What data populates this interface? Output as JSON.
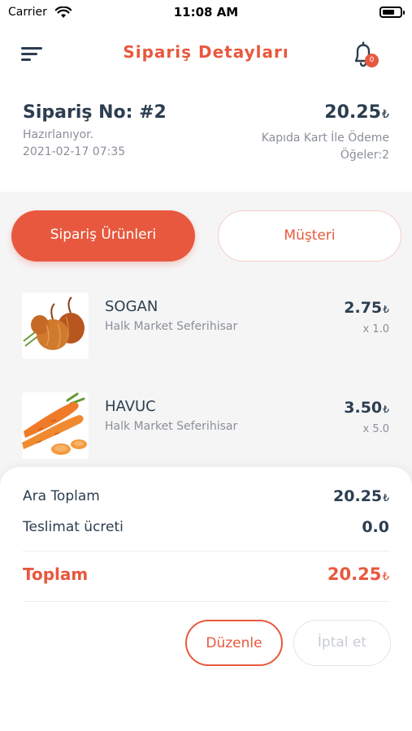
{
  "status_bar": {
    "carrier": "Carrier",
    "time": "11:08 AM"
  },
  "nav": {
    "title": "Sipariş Detayları",
    "notification_count": "0"
  },
  "order": {
    "number": "Sipariş No: #2",
    "status": "Hazırlanıyor.",
    "date": "2021-02-17 07:35",
    "total": "20.25",
    "currency": "₺",
    "payment_method": "Kapıda Kart İle Ödeme",
    "items_count": "Öğeler:2"
  },
  "tabs": {
    "products": "Sipariş Ürünleri",
    "customer": "Müşteri"
  },
  "products": [
    {
      "name": "SOGAN",
      "store": "Halk Market Seferihisar",
      "price": "2.75",
      "qty": "x 1.0"
    },
    {
      "name": "HAVUC",
      "store": "Halk Market Seferihisar",
      "price": "3.50",
      "qty": "x 5.0"
    }
  ],
  "summary": {
    "subtotal_label": "Ara Toplam",
    "subtotal_value": "20.25",
    "delivery_label": "Teslimat ücreti",
    "delivery_value": "0.0",
    "total_label": "Toplam",
    "total_value": "20.25"
  },
  "actions": {
    "edit": "Düzenle",
    "cancel": "İptal et"
  },
  "colors": {
    "accent": "#e8583e",
    "text": "#2c3e50",
    "muted": "#8a8f99"
  }
}
